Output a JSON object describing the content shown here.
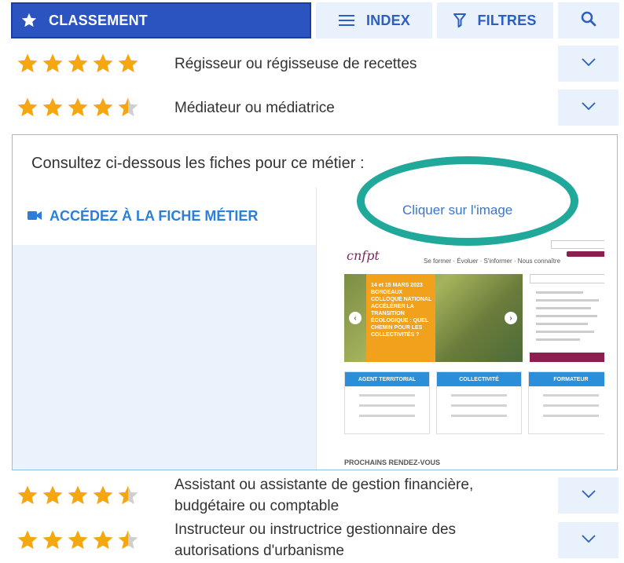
{
  "tabs": {
    "ranking_label": "CLASSEMENT",
    "index_label": "INDEX",
    "filters_label": "FILTRES"
  },
  "jobs": [
    {
      "title_lines": [
        "Régisseur ou régisseuse de recettes"
      ],
      "rating": 5
    },
    {
      "title_lines": [
        "Médiateur ou médiatrice"
      ],
      "rating": 4.5
    },
    {
      "title_lines": [
        "Assistant ou assistante de gestion financière,",
        "budgétaire ou comptable"
      ],
      "rating": 4.5
    },
    {
      "title_lines": [
        "Instructeur ou instructrice gestionnaire des",
        "autorisations d'urbanisme"
      ],
      "rating": 4.5
    }
  ],
  "panel": {
    "intro": "Consultez ci-dessous les fiches pour ce métier :",
    "access_link": "ACCÉDEZ À LA FICHE MÉTIER",
    "click_hint": "Cliquer sur l'image",
    "preview": {
      "logo": "cnfpt",
      "nav": "Se former · Évoluer · S'informer · Nous connaître",
      "hero_text": "14 et 15 MARS 2023 BORDEAUX COLLOQUE NATIONAL ACCÉLÉRER LA TRANSITION ÉCOLOGIQUE : QUEL CHEMIN POUR LES COLLECTIVITÉS ?",
      "cards": [
        "AGENT TERRITORIAL",
        "COLLECTIVITÉ",
        "FORMATEUR"
      ],
      "section_title": "PROCHAINS RENDEZ-VOUS"
    }
  },
  "colors": {
    "active_tab": "#2b54c1",
    "tab_bg": "#e9f1fc",
    "star": "#f5a712",
    "star_empty": "#cfcfcf",
    "oval": "#20a99a",
    "link": "#2b7fd8"
  },
  "icons": {
    "ranking": "star-icon",
    "index": "menu-icon",
    "filters": "filter-icon",
    "search": "search-icon",
    "expand": "chevron-down-icon",
    "access": "video-camera-icon"
  }
}
